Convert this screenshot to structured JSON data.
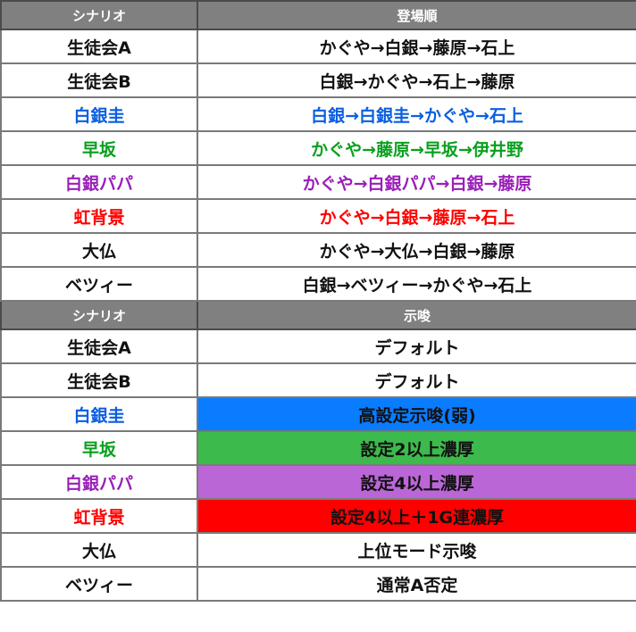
{
  "colors": {
    "blue": "#0a5fe0",
    "green": "#0aa01e",
    "purple": "#9a1fb8",
    "red": "#ff0000",
    "black": "#111111",
    "header_bg": "#808080",
    "bg_blue": "#0a7cff",
    "bg_green": "#3cba4c",
    "bg_purple": "#bb66d6",
    "bg_red": "#ff0000"
  },
  "table1": {
    "headers": [
      "シナリオ",
      "登場順"
    ],
    "rows": [
      {
        "scenario": "生徒会A",
        "order": "かぐや→白銀→藤原→石上",
        "color": "black"
      },
      {
        "scenario": "生徒会B",
        "order": "白銀→かぐや→石上→藤原",
        "color": "black"
      },
      {
        "scenario": "白銀圭",
        "order": "白銀→白銀圭→かぐや→石上",
        "color": "blue"
      },
      {
        "scenario": "早坂",
        "order": "かぐや→藤原→早坂→伊井野",
        "color": "green"
      },
      {
        "scenario": "白銀パパ",
        "order": "かぐや→白銀パパ→白銀→藤原",
        "color": "purple"
      },
      {
        "scenario": "虹背景",
        "order": "かぐや→白銀→藤原→石上",
        "color": "red"
      },
      {
        "scenario": "大仏",
        "order": "かぐや→大仏→白銀→藤原",
        "color": "black"
      },
      {
        "scenario": "ベツィー",
        "order": "白銀→ベツィー→かぐや→石上",
        "color": "black"
      }
    ]
  },
  "table2": {
    "headers": [
      "シナリオ",
      "示唆"
    ],
    "rows": [
      {
        "scenario": "生徒会A",
        "hint": "デフォルト",
        "color": "black",
        "bg": ""
      },
      {
        "scenario": "生徒会B",
        "hint": "デフォルト",
        "color": "black",
        "bg": ""
      },
      {
        "scenario": "白銀圭",
        "hint": "高設定示唆(弱)",
        "color": "blue",
        "bg": "bg_blue"
      },
      {
        "scenario": "早坂",
        "hint": "設定2以上濃厚",
        "color": "green",
        "bg": "bg_green"
      },
      {
        "scenario": "白銀パパ",
        "hint": "設定4以上濃厚",
        "color": "purple",
        "bg": "bg_purple"
      },
      {
        "scenario": "虹背景",
        "hint": "設定4以上＋1G連濃厚",
        "color": "red",
        "bg": "bg_red"
      },
      {
        "scenario": "大仏",
        "hint": "上位モード示唆",
        "color": "black",
        "bg": ""
      },
      {
        "scenario": "ベツィー",
        "hint": "通常A否定",
        "color": "black",
        "bg": ""
      }
    ]
  }
}
